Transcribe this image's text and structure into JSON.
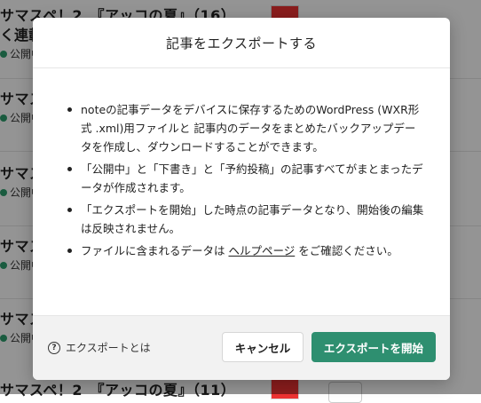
{
  "background": {
    "items": [
      {
        "title": "サマスペ！2　『アッコの夏』（16）",
        "title2": "く連載",
        "status": "公開中"
      },
      {
        "title": "サマス",
        "status": "公開中"
      },
      {
        "title": "サマス",
        "status": "公開中"
      },
      {
        "title": "サマス",
        "status": "公開中"
      },
      {
        "title": "サマス",
        "status": "公開中"
      },
      {
        "title": "サマスペ！2　『アッコの夏』（11）",
        "status": ""
      }
    ]
  },
  "modal": {
    "title": "記事をエクスポートする",
    "bullets": [
      "noteの記事データをデバイスに保存するためのWordPress (WXR形式 .xml)用ファイルと 記事内のデータをまとめたバックアップデータを作成し、ダウンロードすることができます。",
      "「公開中」と「下書き」と「予約投稿」の記事すべてがまとまったデータが作成されます。",
      "「エクスポートを開始」した時点の記事データとなり、開始後の編集は反映されません。"
    ],
    "help_prefix": "ファイルに含まれるデータは ",
    "help_link": "ヘルプページ",
    "help_suffix": " をご確認ください。",
    "about_label": "エクスポートとは",
    "cancel_label": "キャンセル",
    "start_label": "エクスポートを開始"
  },
  "colors": {
    "primary_button": "#2e8f70",
    "status_dot": "#2e9e6d"
  },
  "icons": {
    "about": "question-circle-icon"
  }
}
